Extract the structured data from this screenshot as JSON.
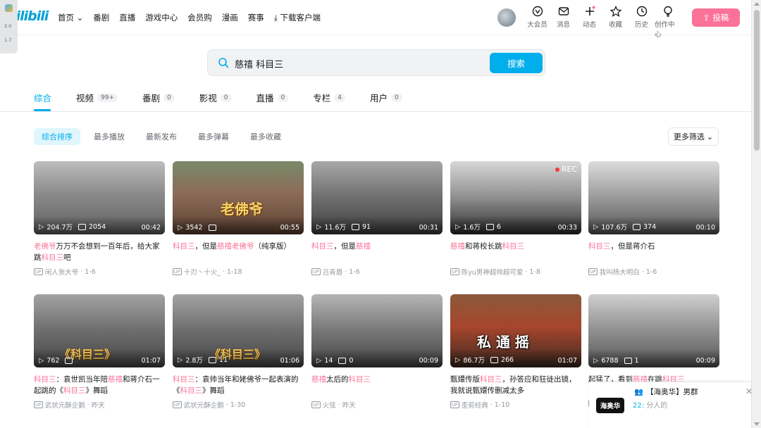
{
  "header": {
    "logo": "bilibili",
    "nav": [
      "首页",
      "番剧",
      "直播",
      "游戏中心",
      "会员购",
      "漫画",
      "赛事",
      "下载客户端"
    ],
    "actions": [
      {
        "label": "大会员",
        "icon": "vip-icon"
      },
      {
        "label": "消息",
        "icon": "message-icon"
      },
      {
        "label": "动态",
        "icon": "dynamic-icon"
      },
      {
        "label": "收藏",
        "icon": "star-icon"
      },
      {
        "label": "历史",
        "icon": "clock-icon"
      },
      {
        "label": "创作中心",
        "icon": "bulb-icon"
      }
    ],
    "upload_label": "投稿"
  },
  "side_widget": {
    "top": "2.0",
    "bottom": "1.7"
  },
  "search": {
    "query": "慈禧 科目三",
    "button": "搜索"
  },
  "tabs": [
    {
      "label": "综合",
      "count": ""
    },
    {
      "label": "视频",
      "count": "99+"
    },
    {
      "label": "番剧",
      "count": "0"
    },
    {
      "label": "影视",
      "count": "0"
    },
    {
      "label": "直播",
      "count": "0"
    },
    {
      "label": "专栏",
      "count": "4"
    },
    {
      "label": "用户",
      "count": "0"
    }
  ],
  "filters": [
    "综合排序",
    "最多播放",
    "最新发布",
    "最多弹幕",
    "最多收藏"
  ],
  "more_filter": "更多筛选",
  "videos": [
    {
      "views": "204.7万",
      "danmaku": "2054",
      "duration": "00:42",
      "title_html": "<span class=\"hl\">老佛爷</span>万万不会想到一百年后，给大家跳<span class=\"hl\">科目三</span>吧",
      "author": "闲人张大爷",
      "date": "1-6",
      "overlay": "",
      "rec": ""
    },
    {
      "views": "3542",
      "danmaku": "",
      "duration": "00:55",
      "title_html": "<span class=\"hl\">科目三</span>，但是<span class=\"hl\">慈禧老佛爷</span>（纯享版）",
      "author": "十刃丶十火_",
      "date": "1-18",
      "overlay": "老佛爷",
      "rec": ""
    },
    {
      "views": "11.6万",
      "danmaku": "91",
      "duration": "00:31",
      "title_html": "<span class=\"hl\">科目三</span>，但是<span class=\"hl\">慈禧</span>",
      "author": "吕青眉",
      "date": "1-6",
      "overlay": "",
      "rec": ""
    },
    {
      "views": "1.6万",
      "danmaku": "6",
      "duration": "00:33",
      "title_html": "<span class=\"hl\">慈禧</span>和蒋校长跳<span class=\"hl\">科目三</span>",
      "author": "陈yu男神超帅超可爱",
      "date": "1-8",
      "overlay": "",
      "rec": "REC"
    },
    {
      "views": "107.6万",
      "danmaku": "374",
      "duration": "00:10",
      "title_html": "<span class=\"hl\">科目三</span>，但是蒋介石",
      "author": "我叫杨大明白",
      "date": "1-6",
      "overlay": "",
      "rec": ""
    },
    {
      "views": "762",
      "danmaku": "",
      "duration": "01:07",
      "title_html": "<span class=\"hl\">科目三</span>：袁世凯当年陪<span class=\"hl\">慈禧</span>和蒋介石一起跳的《<span class=\"hl\">科目三</span>》舞蹈",
      "author": "武状元酥企鹅",
      "date": "昨天",
      "overlay": "《科目三》",
      "rec": ""
    },
    {
      "views": "2.8万",
      "danmaku": "11",
      "duration": "01:06",
      "title_html": "<span class=\"hl\">科目三</span>：袁帅当年和姥佛爷一起表演的《<span class=\"hl\">科目三</span>》舞蹈",
      "author": "武状元酥企鹅",
      "date": "1-30",
      "overlay": "《科目三》",
      "rec": ""
    },
    {
      "views": "14",
      "danmaku": "0",
      "duration": "00:09",
      "title_html": "<span class=\"hl\">慈禧</span>太后的<span class=\"hl\">科目三</span>",
      "author": "火弦",
      "date": "昨天",
      "overlay": "",
      "rec": ""
    },
    {
      "views": "86.7万",
      "danmaku": "266",
      "duration": "01:07",
      "title_html": "甄嬛传版<span class=\"hl\">科目三</span>，孙答应和狂徒出镜，我就说甄嬛传删减太多",
      "author": "歪剪经典",
      "date": "1-10",
      "overlay": "私 通 摇",
      "rec": ""
    },
    {
      "views": "6788",
      "danmaku": "1",
      "duration": "00:09",
      "title_html": "起猛了，看到<span class=\"hl\">慈禧</span>在跳<span class=\"hl\">科目三</span>",
      "author": "",
      "date": "",
      "overlay": "",
      "rec": ""
    }
  ],
  "popup": {
    "logo": "海奥华",
    "title": "【海奥华】男群",
    "count": "22:",
    "text": "分人的"
  },
  "colors": {
    "accent": "#00aeec",
    "pink": "#fb7299"
  }
}
